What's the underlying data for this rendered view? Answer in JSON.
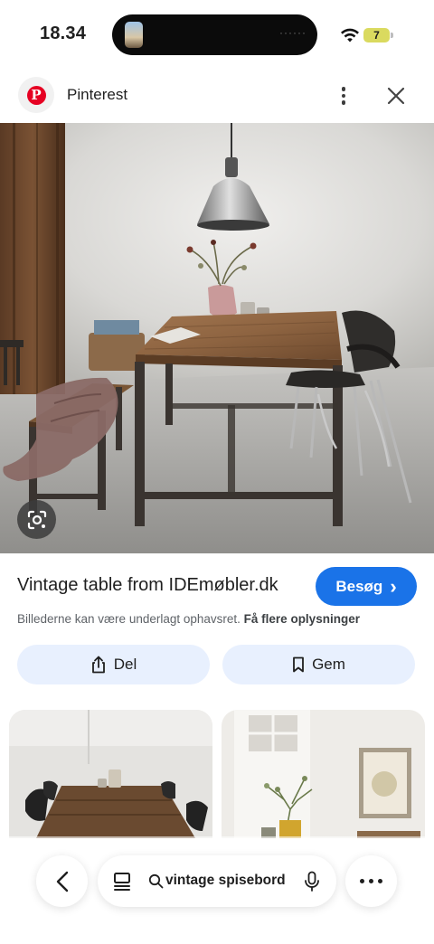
{
  "status_bar": {
    "time": "18.34",
    "battery": "7",
    "island_dots": "······"
  },
  "header": {
    "logo_letter": "P",
    "title": "Pinterest"
  },
  "result": {
    "title": "Vintage table from IDEmøbler.dk",
    "visit_label": "Besøg",
    "visit_chevron": "›",
    "copyright_text": "Billederne kan være underlagt ophavsret.",
    "more_info_link": "Få flere oplysninger"
  },
  "actions": {
    "share_label": "Del",
    "save_label": "Gem"
  },
  "bottom_bar": {
    "search_query": "vintage spisebord"
  },
  "colors": {
    "accent": "#1a73e8",
    "pinterest_red": "#e60023",
    "action_bg": "#e8f0fe"
  }
}
